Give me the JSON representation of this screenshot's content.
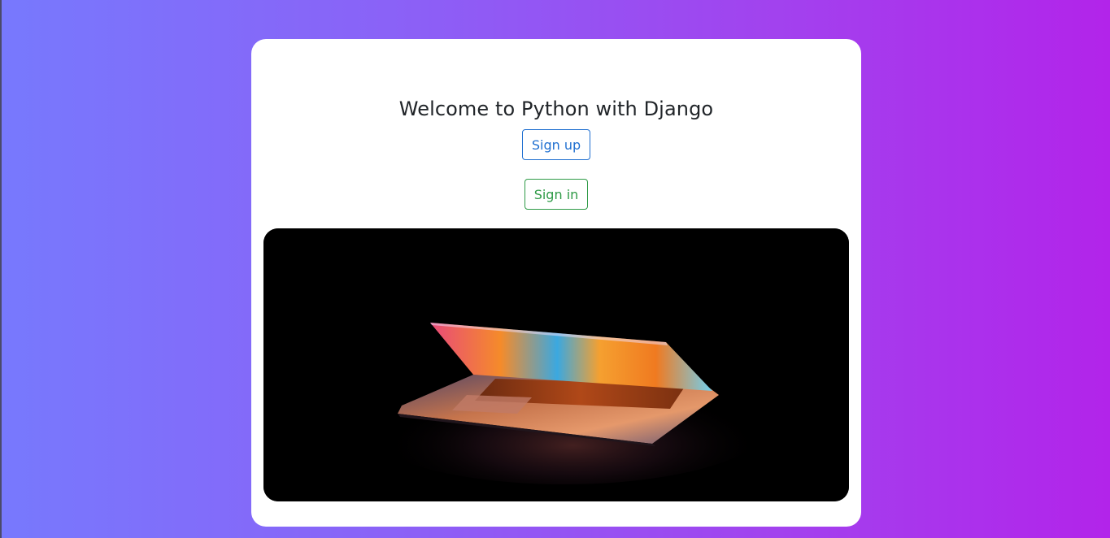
{
  "page": {
    "heading": "Welcome to Python with Django"
  },
  "actions": {
    "signup_label": "Sign up",
    "signin_label": "Sign in"
  },
  "hero": {
    "alt": "Laptop partially open with colorful screen glow in the dark"
  },
  "colors": {
    "background_start": "#7779fd",
    "background_end": "#b224ea",
    "signup_accent": "#1f6fd0",
    "signin_accent": "#2e9a46"
  }
}
